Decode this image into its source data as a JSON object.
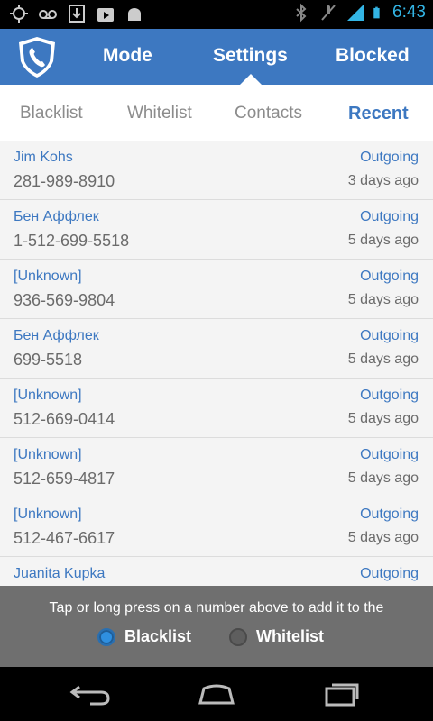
{
  "status_bar": {
    "time": "6:43",
    "network": "3G",
    "icons": [
      "gps-icon",
      "voicemail-icon",
      "download-icon",
      "play-store-icon",
      "android-icon",
      "bluetooth-icon",
      "mute-icon",
      "signal-icon",
      "battery-icon"
    ]
  },
  "top_nav": {
    "items": [
      {
        "label": "Mode"
      },
      {
        "label": "Settings"
      },
      {
        "label": "Blocked"
      }
    ],
    "selected": "Settings",
    "color": "#3d78c1"
  },
  "sub_tabs": {
    "items": [
      {
        "label": "Blacklist"
      },
      {
        "label": "Whitelist"
      },
      {
        "label": "Contacts"
      },
      {
        "label": "Recent"
      }
    ],
    "selected": "Recent"
  },
  "calls": [
    {
      "name": "Jim Kohs",
      "number": "281-989-8910",
      "type": "Outgoing",
      "when": "3 days ago"
    },
    {
      "name": "Бен Аффлек",
      "number": "1-512-699-5518",
      "type": "Outgoing",
      "when": "5 days ago"
    },
    {
      "name": "[Unknown]",
      "number": "936-569-9804",
      "type": "Outgoing",
      "when": "5 days ago"
    },
    {
      "name": "Бен Аффлек",
      "number": "699-5518",
      "type": "Outgoing",
      "when": "5 days ago"
    },
    {
      "name": "[Unknown]",
      "number": "512-669-0414",
      "type": "Outgoing",
      "when": "5 days ago"
    },
    {
      "name": "[Unknown]",
      "number": "512-659-4817",
      "type": "Outgoing",
      "when": "5 days ago"
    },
    {
      "name": "[Unknown]",
      "number": "512-467-6617",
      "type": "Outgoing",
      "when": "5 days ago"
    },
    {
      "name": "Juanita Kupka",
      "number": "",
      "type": "Outgoing",
      "when": ""
    }
  ],
  "bottom_panel": {
    "hint": "Tap or long press on a number above to add it to the",
    "options": [
      {
        "label": "Blacklist",
        "checked": true
      },
      {
        "label": "Whitelist",
        "checked": false
      }
    ]
  }
}
